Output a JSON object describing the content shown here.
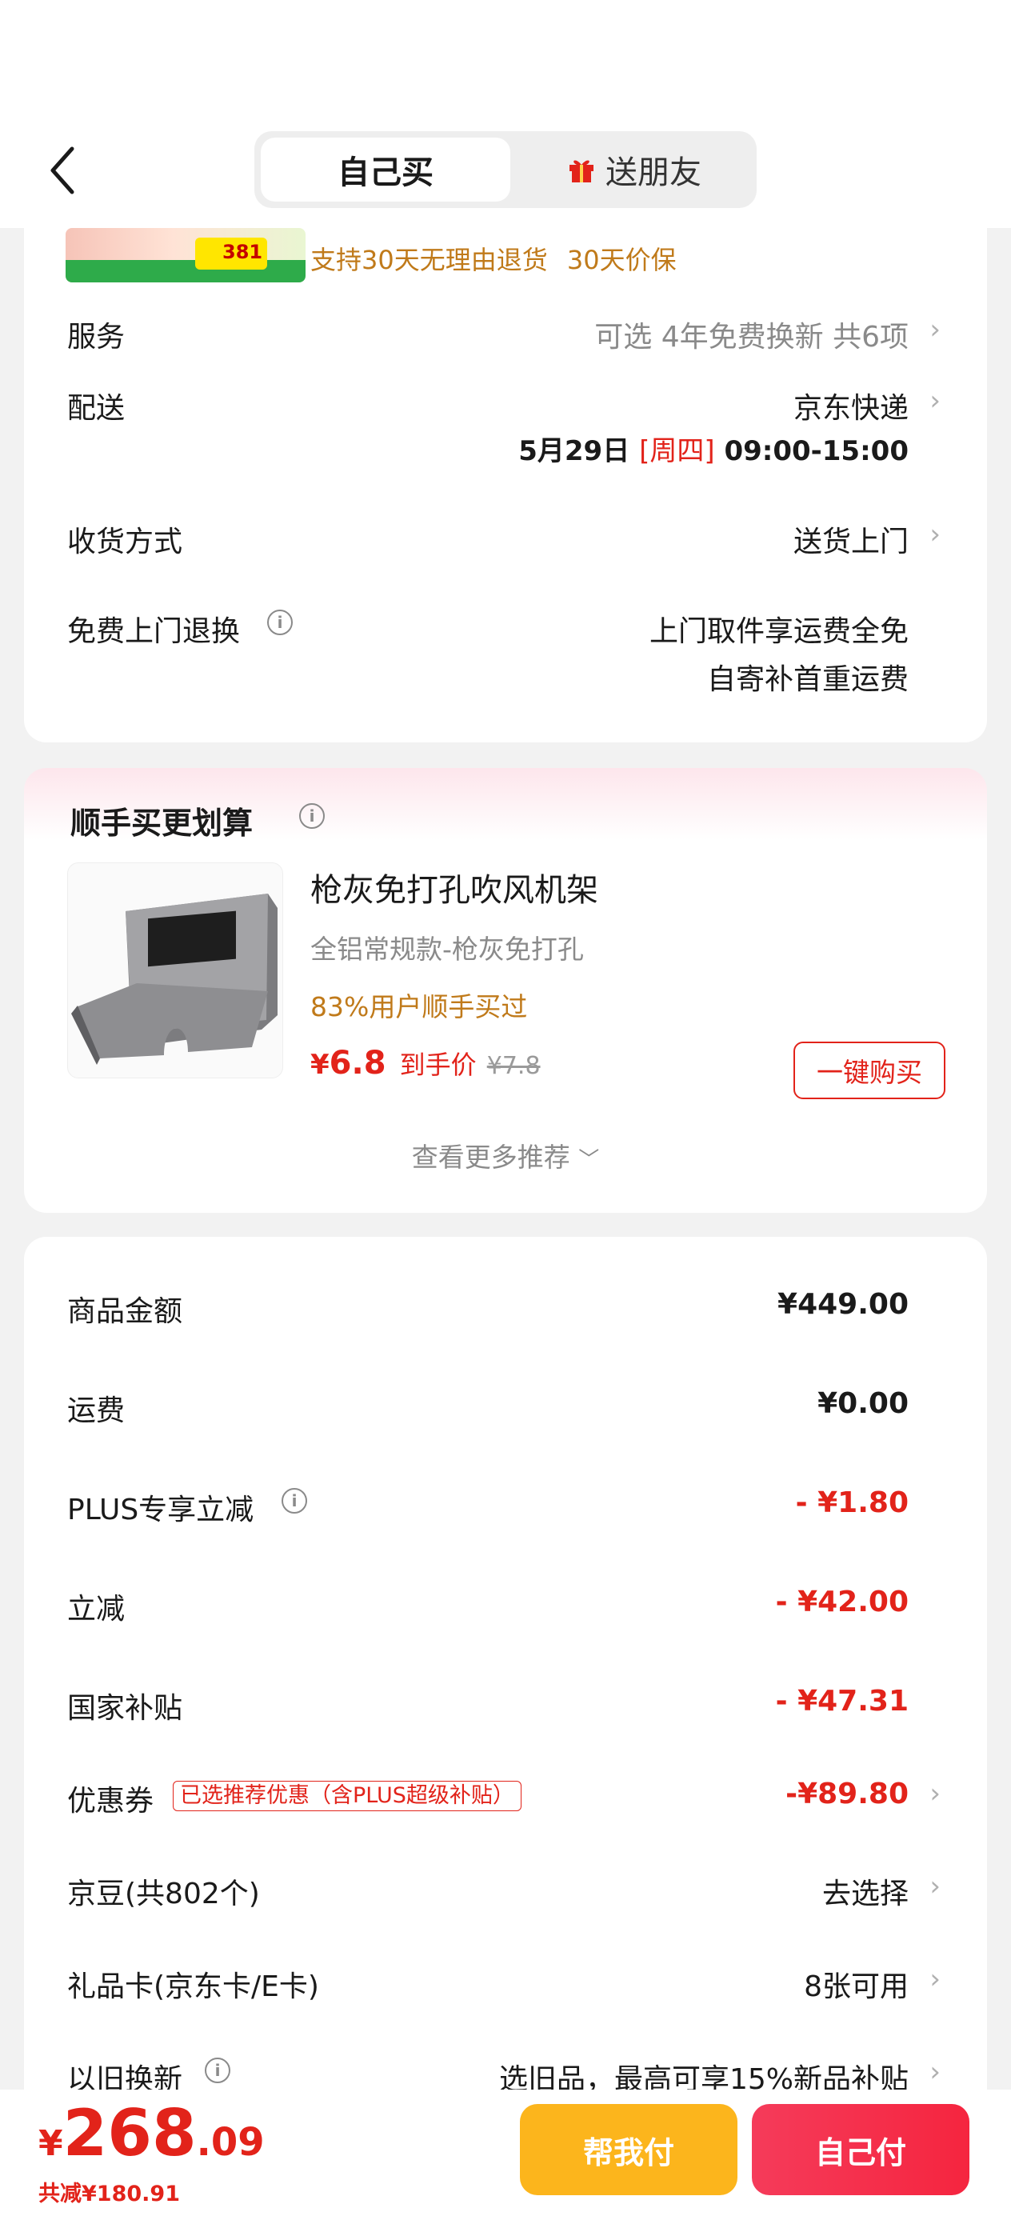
{
  "tabs": {
    "self": "自己买",
    "friend": "送朋友"
  },
  "product_top": {
    "service_note": "支持30天无理由退货",
    "price_protect": "30天价保",
    "thumb_price": "381"
  },
  "shipping": {
    "service_label": "服务",
    "service_value": "可选 4年免费换新 共6项",
    "delivery_label": "配送",
    "delivery_value": "京东快递",
    "delivery_date": "5月29日",
    "delivery_weekday": "[周四]",
    "delivery_time": "09:00-15:00",
    "receive_label": "收货方式",
    "receive_value": "送货上门",
    "return_label": "免费上门退换",
    "return_line1": "上门取件享运费全免",
    "return_line2": "自寄补首重运费"
  },
  "addon": {
    "title": "顺手买更划算",
    "product_name": "枪灰免打孔吹风机架",
    "product_spec": "全铝常规款-枪灰免打孔",
    "buy_rate": "83%用户顺手买过",
    "price_symbol": "¥",
    "price": "6.8",
    "price_label": "到手价",
    "original_price": "¥7.8",
    "buy_button": "一键购买",
    "more": "查看更多推荐"
  },
  "summary": {
    "goods_label": "商品金额",
    "goods_value": "¥449.00",
    "freight_label": "运费",
    "freight_value": "¥0.00",
    "plus_label": "PLUS专享立减",
    "plus_value": "- ¥1.80",
    "discount_label": "立减",
    "discount_value": "- ¥42.00",
    "subsidy_label": "国家补贴",
    "subsidy_value": "- ¥47.31",
    "coupon_label": "优惠券",
    "coupon_tag": "已选推荐优惠（含PLUS超级补贴）",
    "coupon_value": "-¥89.80",
    "jingdou_label": "京豆(共802个)",
    "jingdou_value": "去选择",
    "giftcard_label": "礼品卡(京东卡/E卡)",
    "giftcard_value": "8张可用",
    "tradein_label": "以旧换新",
    "tradein_value": "选旧品，最高可享15%新品补贴"
  },
  "footer": {
    "currency": "¥",
    "total_int": "268",
    "total_dec": ".09",
    "saved": "共减¥180.91",
    "help_pay": "帮我付",
    "self_pay": "自己付"
  },
  "colors": {
    "accent_red": "#e2231a",
    "gold": "#c07a1a",
    "help_btn": "#fcb51c",
    "pay_btn": "#f5253f"
  }
}
